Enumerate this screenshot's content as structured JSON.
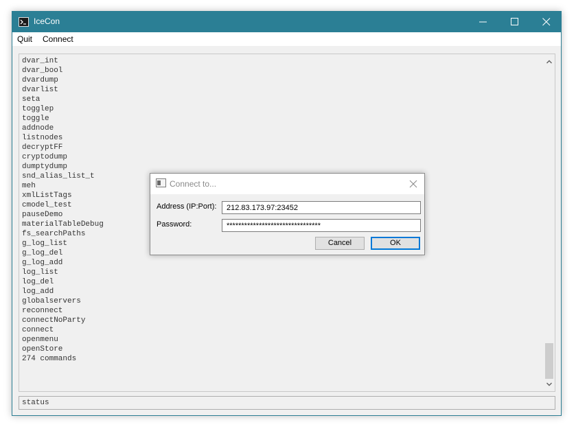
{
  "window": {
    "title": "IceCon",
    "accent_color": "#2b7f95"
  },
  "menu": {
    "quit_label": "Quit",
    "connect_label": "Connect"
  },
  "console": {
    "lines": [
      "dvar_int",
      "dvar_bool",
      "dvardump",
      "dvarlist",
      "seta",
      "togglep",
      "toggle",
      "addnode",
      "listnodes",
      "decryptFF",
      "cryptodump",
      "dumptydump",
      "snd_alias_list_t",
      "meh",
      "xmlListTags",
      "cmodel_test",
      "pauseDemo",
      "materialTableDebug",
      "fs_searchPaths",
      "g_log_list",
      "g_log_del",
      "g_log_add",
      "log_list",
      "log_del",
      "log_add",
      "globalservers",
      "reconnect",
      "connectNoParty",
      "connect",
      "openmenu",
      "openStore",
      "274 commands"
    ]
  },
  "status": {
    "text": "status"
  },
  "dialog": {
    "title": "Connect to...",
    "address_label": "Address (IP:Port):",
    "address_value": "212.83.173.97:23452",
    "password_label": "Password:",
    "password_value": "********************************",
    "cancel_label": "Cancel",
    "ok_label": "OK",
    "focus_color": "#0078d7"
  }
}
